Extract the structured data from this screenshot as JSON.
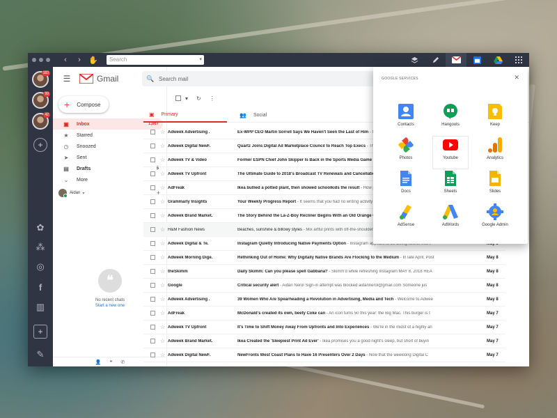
{
  "window": {
    "toolbar_search_placeholder": "Search"
  },
  "dock": {
    "badges": [
      "183",
      "99",
      "42"
    ]
  },
  "gmail": {
    "brand": "Gmail",
    "search_placeholder": "Search mail",
    "compose_label": "Compose",
    "nav": [
      {
        "label": "Inbox",
        "count": "1,067",
        "icon": "inbox-icon"
      },
      {
        "label": "Starred",
        "count": "",
        "icon": "star-icon"
      },
      {
        "label": "Snoozed",
        "count": "",
        "icon": "clock-icon"
      },
      {
        "label": "Sent",
        "count": "",
        "icon": "send-icon"
      },
      {
        "label": "Drafts",
        "count": "5",
        "icon": "draft-icon"
      },
      {
        "label": "More",
        "count": "",
        "icon": "chevron-down-icon"
      }
    ],
    "hangout_user": "Aidan",
    "no_chats": "No recent chats",
    "start_chat": "Start a new one",
    "tabs": {
      "primary": "Primary",
      "social": "Social"
    },
    "emails": [
      {
        "sender": "Adweek Advertising .",
        "subject": "Ex-WPP CEO Martin Sorrell Says We Haven't Seen the Last of Him",
        "snippet": " - Martin",
        "date": "",
        "read": false
      },
      {
        "sender": "Adweek Digital NewF.",
        "subject": "Quartz Joins Digital Ad Marketplace Council to Reach Top Execs",
        "snippet": " - The n",
        "date": "",
        "read": false
      },
      {
        "sender": "Adweek TV & Video",
        "subject": "Former ESPN Chief John Skipper Is Back in the Sports Media Game",
        "snippet": " - Fo",
        "date": "",
        "read": false
      },
      {
        "sender": "Adweek TV Upfront",
        "subject": "The Ultimate Guide to 2018's Broadcast TV Renewals and Cancellations",
        "snippet": " -",
        "date": "",
        "read": false
      },
      {
        "sender": "AdFreak",
        "subject": "Ikea bullied a potted plant, then showed schoolkids the result",
        "snippet": " - How pow",
        "date": "",
        "read": false
      },
      {
        "sender": "Grammarly Insights",
        "subject": "Your Weekly Progress Report",
        "snippet": " - It seems that you had no writing activity w",
        "date": "",
        "read": false
      },
      {
        "sender": "Adweek Brand Market.",
        "subject": "The Story Behind the La-Z-Boy Recliner Begins With an Old Orange Crate",
        "snippet": "",
        "date": "",
        "read": false
      },
      {
        "sender": "H&M Fashion News",
        "subject": "Beaches, sunshine & billowy styles",
        "snippet": " - Mix artful prints with off-the-shoulder",
        "date": "",
        "read": true
      },
      {
        "sender": "Adweek Digital & Te.",
        "subject": "Instagram Quietly Introducing Native Payments Option",
        "snippet": " - Instagram appears to be diving further into t",
        "date": "May 8",
        "read": false
      },
      {
        "sender": "Adweek Morning Dige.",
        "subject": "Rethinking Out of Home: Why Digitally Native Brands Are Flocking to the Medium",
        "snippet": " - In late April, Post",
        "date": "May 8",
        "read": false
      },
      {
        "sender": "theSkimm",
        "subject": "Daily Skimm: Can you please spell Gabbana?",
        "snippet": " - Skimm'd while refreshing Instagram MAY 8, 2018 REA",
        "date": "May 8",
        "read": false
      },
      {
        "sender": "Google",
        "subject": "Critical security alert",
        "snippet": " - Aidan Nerol Sign-in attempt was blocked aidannerol@gmail.com Someone jus",
        "date": "May 8",
        "read": false
      },
      {
        "sender": "Adweek Advertising .",
        "subject": "39 Women Who Are Spearheading a Revolution in Advertising, Media and Tech",
        "snippet": " - Welcome to Adwee",
        "date": "May 8",
        "read": false
      },
      {
        "sender": "AdFreak",
        "subject": "McDonald's created its own, beefy Coke can",
        "snippet": " - An icon turns 50 this year: the Big Mac. This burger is t",
        "date": "May 7",
        "read": false
      },
      {
        "sender": "Adweek TV Upfront",
        "subject": "It's Time to Shift Money Away From Upfronts and Into Experiences",
        "snippet": " - We're in the midst of a highly an",
        "date": "May 7",
        "read": false
      },
      {
        "sender": "Adweek Brand Market.",
        "subject": "Ikea Created the 'Sleepiest Print Ad Ever'",
        "snippet": " - Ikea promises you a good night's sleep, but short of buyin",
        "date": "May 7",
        "read": false
      },
      {
        "sender": "Adweek Digital NewF.",
        "subject": "NewFronts West Coast Plans to Have 16 Presenters Over 2 Days",
        "snippet": " - Now that the weeklong Digital C",
        "date": "May 7",
        "read": false
      }
    ]
  },
  "google_services": {
    "title": "GOOGLE SERVICES",
    "apps": [
      {
        "label": "Contacts",
        "icon": "contacts-icon"
      },
      {
        "label": "Hangouts",
        "icon": "hangouts-icon"
      },
      {
        "label": "Keep",
        "icon": "keep-icon"
      },
      {
        "label": "Photos",
        "icon": "photos-icon"
      },
      {
        "label": "Youtube",
        "icon": "youtube-icon"
      },
      {
        "label": "Analytics",
        "icon": "analytics-icon"
      },
      {
        "label": "Docs",
        "icon": "docs-icon"
      },
      {
        "label": "Sheets",
        "icon": "sheets-icon"
      },
      {
        "label": "Slides",
        "icon": "slides-icon"
      },
      {
        "label": "AdSense",
        "icon": "adsense-icon"
      },
      {
        "label": "AdWords",
        "icon": "adwords-icon"
      },
      {
        "label": "Google Admin",
        "icon": "google-admin-icon"
      }
    ]
  },
  "colors": {
    "chrome": "#2f3543",
    "gmail_red": "#d93025",
    "link_blue": "#1a73e8"
  }
}
